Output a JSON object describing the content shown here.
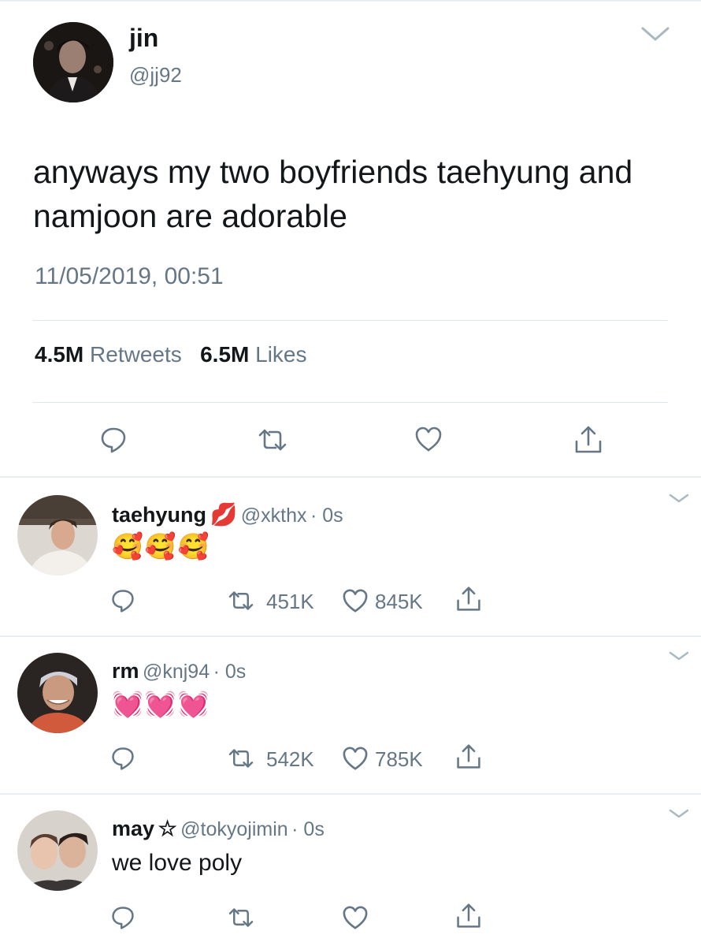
{
  "main_tweet": {
    "name": "jin",
    "handle": "@jj92",
    "text": "anyways my two boyfriends taehyung and namjoon are adorable",
    "timestamp": "11/05/2019, 00:51",
    "retweets_count": "4.5M",
    "retweets_label": "Retweets",
    "likes_count": "6.5M",
    "likes_label": "Likes"
  },
  "replies": [
    {
      "name": "taehyung",
      "badge": "💋",
      "handle": "@xkthx",
      "time": "· 0s",
      "text": "🥰🥰🥰",
      "retweets": "451K",
      "likes": "845K"
    },
    {
      "name": "rm",
      "handle": "@knj94",
      "time": "· 0s",
      "text": "💓💓💓",
      "retweets": "542K",
      "likes": "785K"
    },
    {
      "name": "may",
      "badge": "☆",
      "handle": "@tokyojimin",
      "time": "· 0s",
      "text": "we love poly"
    }
  ],
  "icons": [
    "chevron-down-icon",
    "reply-icon",
    "retweet-icon",
    "like-icon",
    "share-icon"
  ],
  "colors": {
    "text": "#14171a",
    "secondary": "#657786",
    "divider": "#e6ecf0"
  }
}
